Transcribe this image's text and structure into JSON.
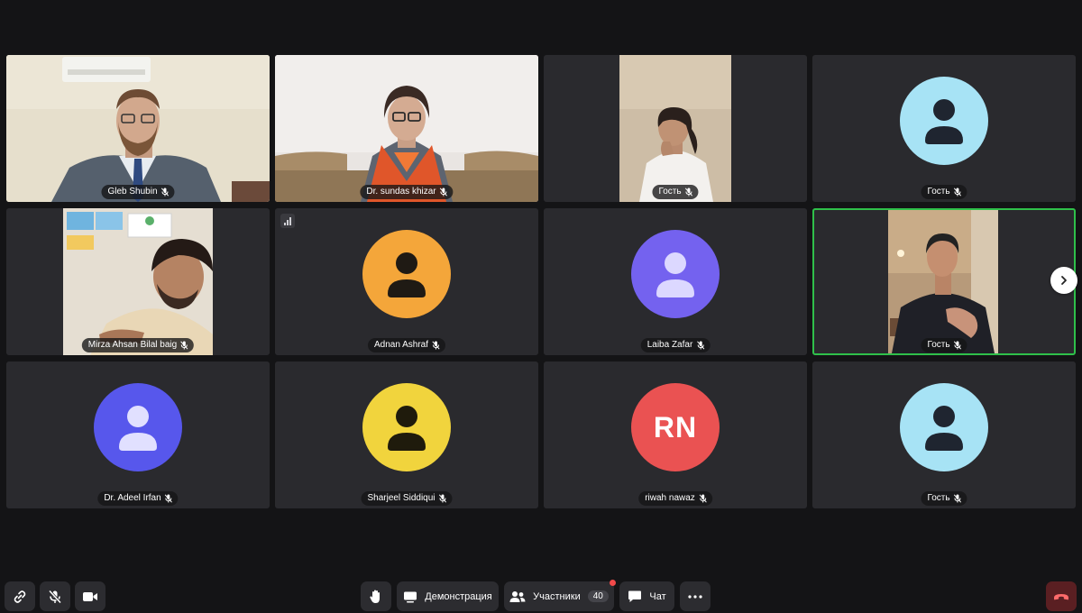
{
  "participants": [
    {
      "name": "Gleb Shubin",
      "type": "video",
      "mic": "muted"
    },
    {
      "name": "Dr. sundas khizar",
      "type": "video",
      "mic": "muted"
    },
    {
      "name": "Гость",
      "type": "video",
      "mic": "muted"
    },
    {
      "name": "Гость",
      "type": "avatar",
      "avatar_color": "#a7e3f5",
      "icon_color": "#1f2530",
      "mic": "muted"
    },
    {
      "name": "Mirza Ahsan Bilal baig",
      "type": "video",
      "mic": "muted"
    },
    {
      "name": "Adnan Ashraf",
      "type": "avatar",
      "avatar_color": "#f4a63a",
      "icon_color": "#1f1a14",
      "mic": "muted"
    },
    {
      "name": "Laiba Zafar",
      "type": "avatar",
      "avatar_color": "#7462ef",
      "icon_color": "#dcd8ff",
      "mic": "muted"
    },
    {
      "name": "Гость",
      "type": "video",
      "mic": "muted",
      "active": true
    },
    {
      "name": "Dr. Adeel Irfan",
      "type": "avatar",
      "avatar_color": "#5757ec",
      "icon_color": "#e1e0ff",
      "mic": "muted"
    },
    {
      "name": "Sharjeel Siddiqui",
      "type": "avatar",
      "avatar_color": "#f1d43d",
      "icon_color": "#1f1b0c",
      "mic": "muted"
    },
    {
      "name": "riwah nawaz",
      "type": "initials",
      "initials": "RN",
      "avatar_color": "#ea5252",
      "mic": "muted"
    },
    {
      "name": "Гость",
      "type": "avatar",
      "avatar_color": "#a7e3f5",
      "icon_color": "#1f2530",
      "mic": "muted"
    }
  ],
  "toolbar": {
    "link_icon": "link-icon",
    "mic_icon": "mic-muted-icon",
    "camera_icon": "camera-icon",
    "raise_hand_icon": "hand-icon",
    "screenshare_label": "Демонстрация",
    "participants_label": "Участники",
    "participants_count": "40",
    "chat_label": "Чат",
    "more_icon": "more-icon",
    "leave_icon": "leave-call-icon"
  },
  "colors": {
    "background": "#141416",
    "tile": "#2a2a2e",
    "active_border": "#2fc04a",
    "leave": "#5a1f22",
    "notification": "#f24a4a"
  }
}
